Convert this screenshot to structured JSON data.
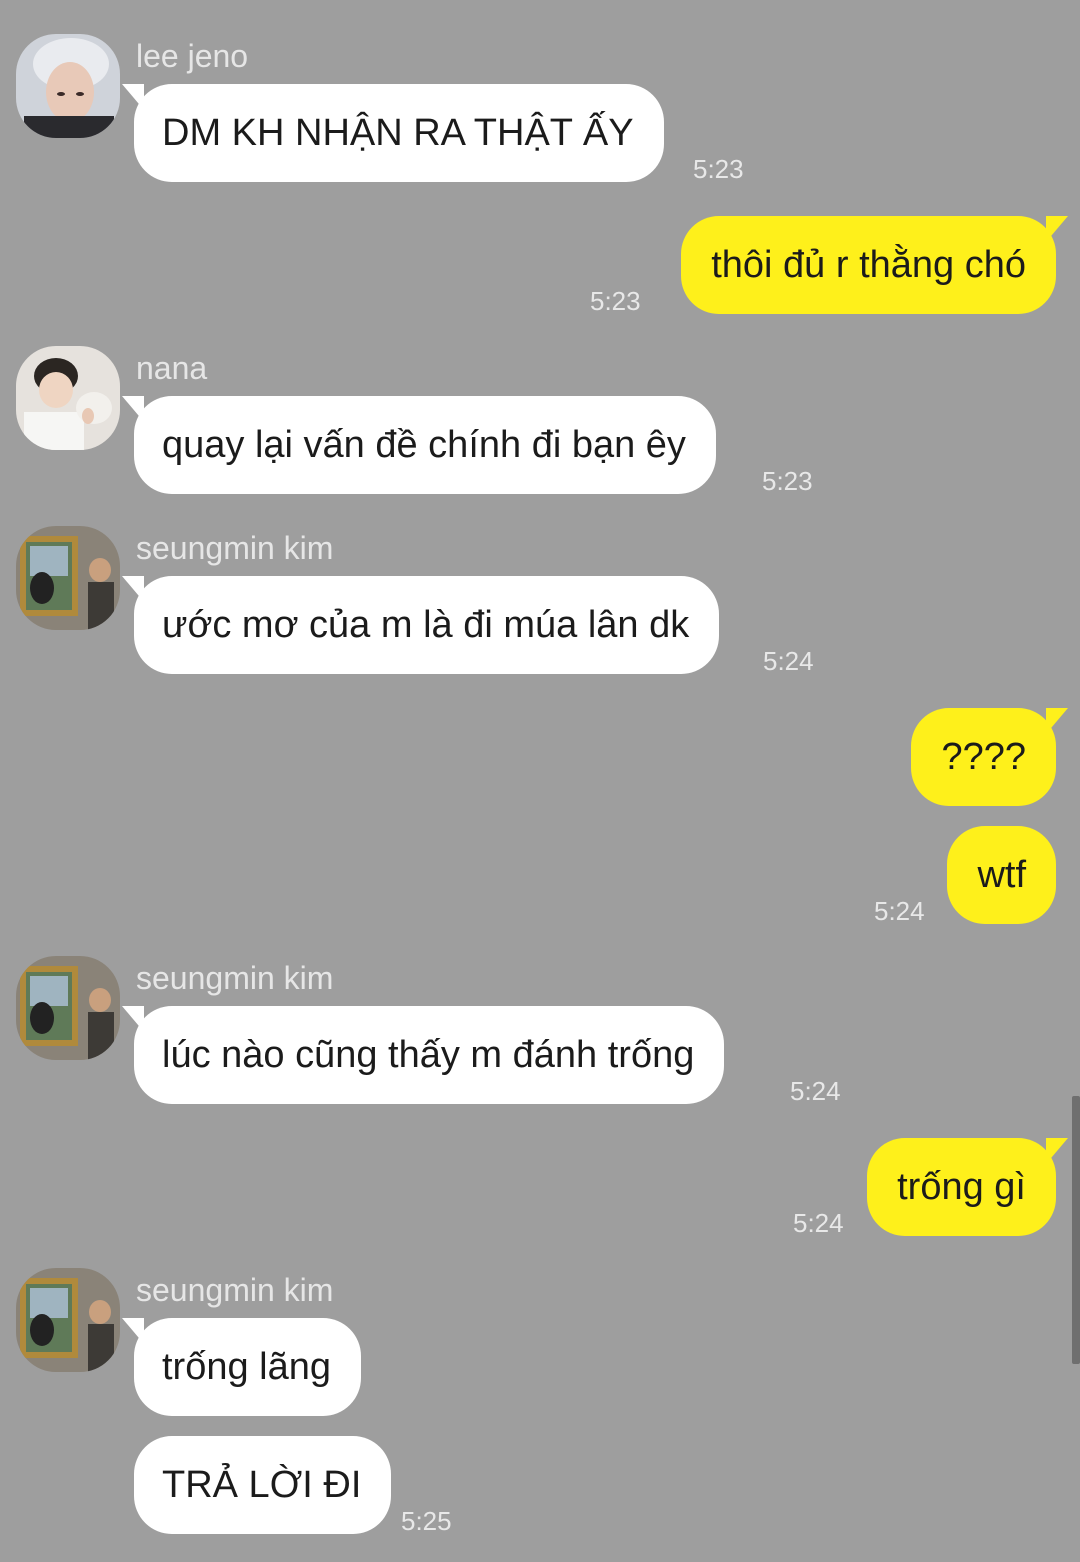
{
  "messages": {
    "m1": {
      "sender": "lee jeno",
      "text": "DM KH NHẬN RA THẬT ẤY",
      "time": "5:23"
    },
    "m2": {
      "text": "thôi đủ r thằng chó",
      "time": "5:23"
    },
    "m3": {
      "sender": "nana",
      "text": "quay lại vấn đề chính đi bạn êy",
      "time": "5:23"
    },
    "m4": {
      "sender": "seungmin kim",
      "text": "ước mơ của m là đi múa lân dk",
      "time": "5:24"
    },
    "m5": {
      "text": "????"
    },
    "m6": {
      "text": "wtf",
      "time": "5:24"
    },
    "m7": {
      "sender": "seungmin kim",
      "text": "lúc nào cũng thấy m đánh trống",
      "time": "5:24"
    },
    "m8": {
      "text": "trống gì",
      "time": "5:24"
    },
    "m9": {
      "sender": "seungmin kim",
      "text": "trống lãng"
    },
    "m10": {
      "text": "TRẢ LỜI ĐI",
      "time": "5:25"
    }
  },
  "colors": {
    "background": "#9e9e9e",
    "incoming_bubble": "#ffffff",
    "outgoing_bubble": "#fef01b"
  }
}
